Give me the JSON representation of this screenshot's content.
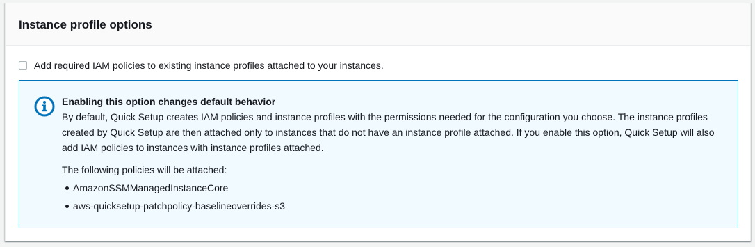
{
  "section": {
    "title": "Instance profile options"
  },
  "option": {
    "checkbox_label": "Add required IAM policies to existing instance profiles attached to your instances.",
    "checked": false
  },
  "info": {
    "icon": "info-icon",
    "heading": "Enabling this option changes default behavior",
    "body": "By default, Quick Setup creates IAM policies and instance profiles with the permissions needed for the configuration you choose. The instance profiles created by Quick Setup are then attached only to instances that do not have an instance profile attached. If you enable this option, Quick Setup will also add IAM policies to instances with instance profiles attached.",
    "policies_intro": "The following policies will be attached:",
    "policies": [
      "AmazonSSMManagedInstanceCore",
      "aws-quicksetup-patchpolicy-baselineoverrides-s3"
    ]
  },
  "colors": {
    "info_border": "#0073bb",
    "info_background": "#f1faff",
    "icon_blue": "#0073bb"
  }
}
